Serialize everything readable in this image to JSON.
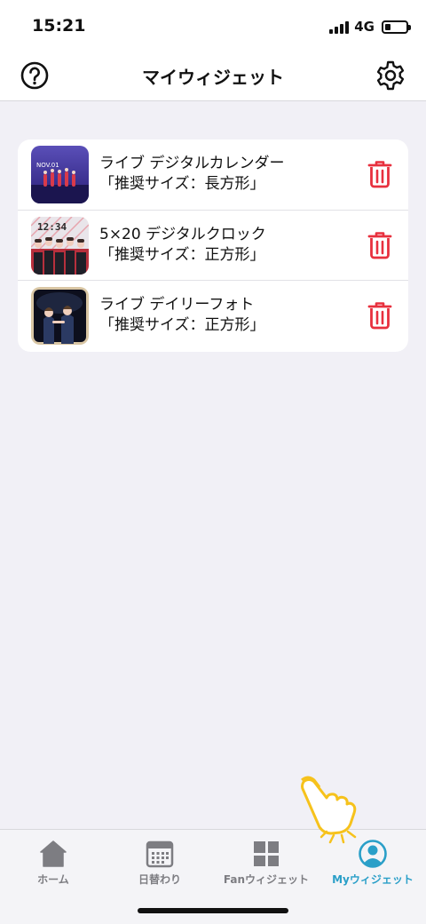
{
  "status": {
    "time": "15:21",
    "network": "4G",
    "battery_level": 0.25
  },
  "header": {
    "title": "マイウィジェット",
    "help_icon": "help-circle-icon",
    "settings_icon": "gear-icon"
  },
  "widgets": [
    {
      "title": "ライブ デジタルカレンダー",
      "size": "「推奨サイズ：長方形」",
      "thumb_label": "NOV.01",
      "thumb_icon": "live-photo-thumbnail"
    },
    {
      "title": "5×20 デジタルクロック",
      "size": "「推奨サイズ：正方形」",
      "thumb_label": "12:34",
      "thumb_icon": "clock-photo-thumbnail"
    },
    {
      "title": "ライブ デイリーフォト",
      "size": "「推奨サイズ：正方形」",
      "thumb_label": "",
      "thumb_icon": "daily-photo-thumbnail"
    }
  ],
  "tabs": [
    {
      "label": "ホーム",
      "icon": "home-icon",
      "active": false
    },
    {
      "label": "日替わり",
      "icon": "calendar-icon",
      "active": false
    },
    {
      "label": "Fanウィジェット",
      "icon": "grid-icon",
      "active": false
    },
    {
      "label": "Myウィジェット",
      "icon": "user-circle-icon",
      "active": true
    }
  ],
  "colors": {
    "accent": "#2a9fc8",
    "delete": "#e8303e",
    "background": "#f1f0f6",
    "pointer": "#f6c21c"
  }
}
